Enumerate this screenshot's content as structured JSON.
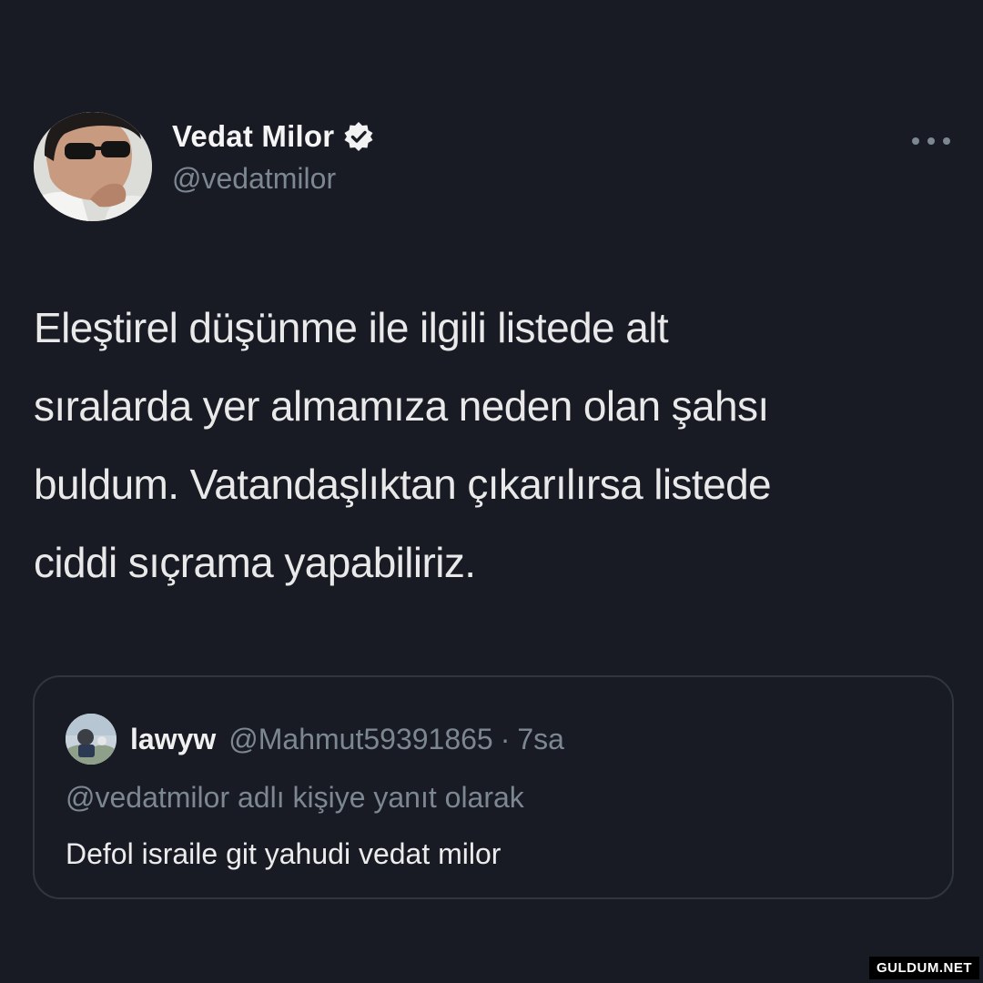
{
  "tweet": {
    "display_name": "Vedat Milor",
    "handle": "@vedatmilor",
    "verified": true,
    "text_lines": [
      "Eleştirel düşünme ile ilgili listede alt",
      "sıralarda yer almamıza neden olan şahsı",
      "buldum. Vatandaşlıktan çıkarılırsa listede",
      "ciddi sıçrama yapabiliriz."
    ]
  },
  "quoted_tweet": {
    "display_name": "lawyw",
    "handle": "@Mahmut59391865",
    "separator": "·",
    "time": "7sa",
    "reply_context": "@vedatmilor adlı kişiye yanıt olarak",
    "text": "Defol israile git yahudi vedat milor"
  },
  "icons": {
    "verified": "verified-badge-icon",
    "more": "more-options-icon"
  },
  "colors": {
    "background": "#181b24",
    "secondary_text": "#7d8791",
    "card_border": "#2f3640"
  },
  "watermark": "GULDUM.NET"
}
